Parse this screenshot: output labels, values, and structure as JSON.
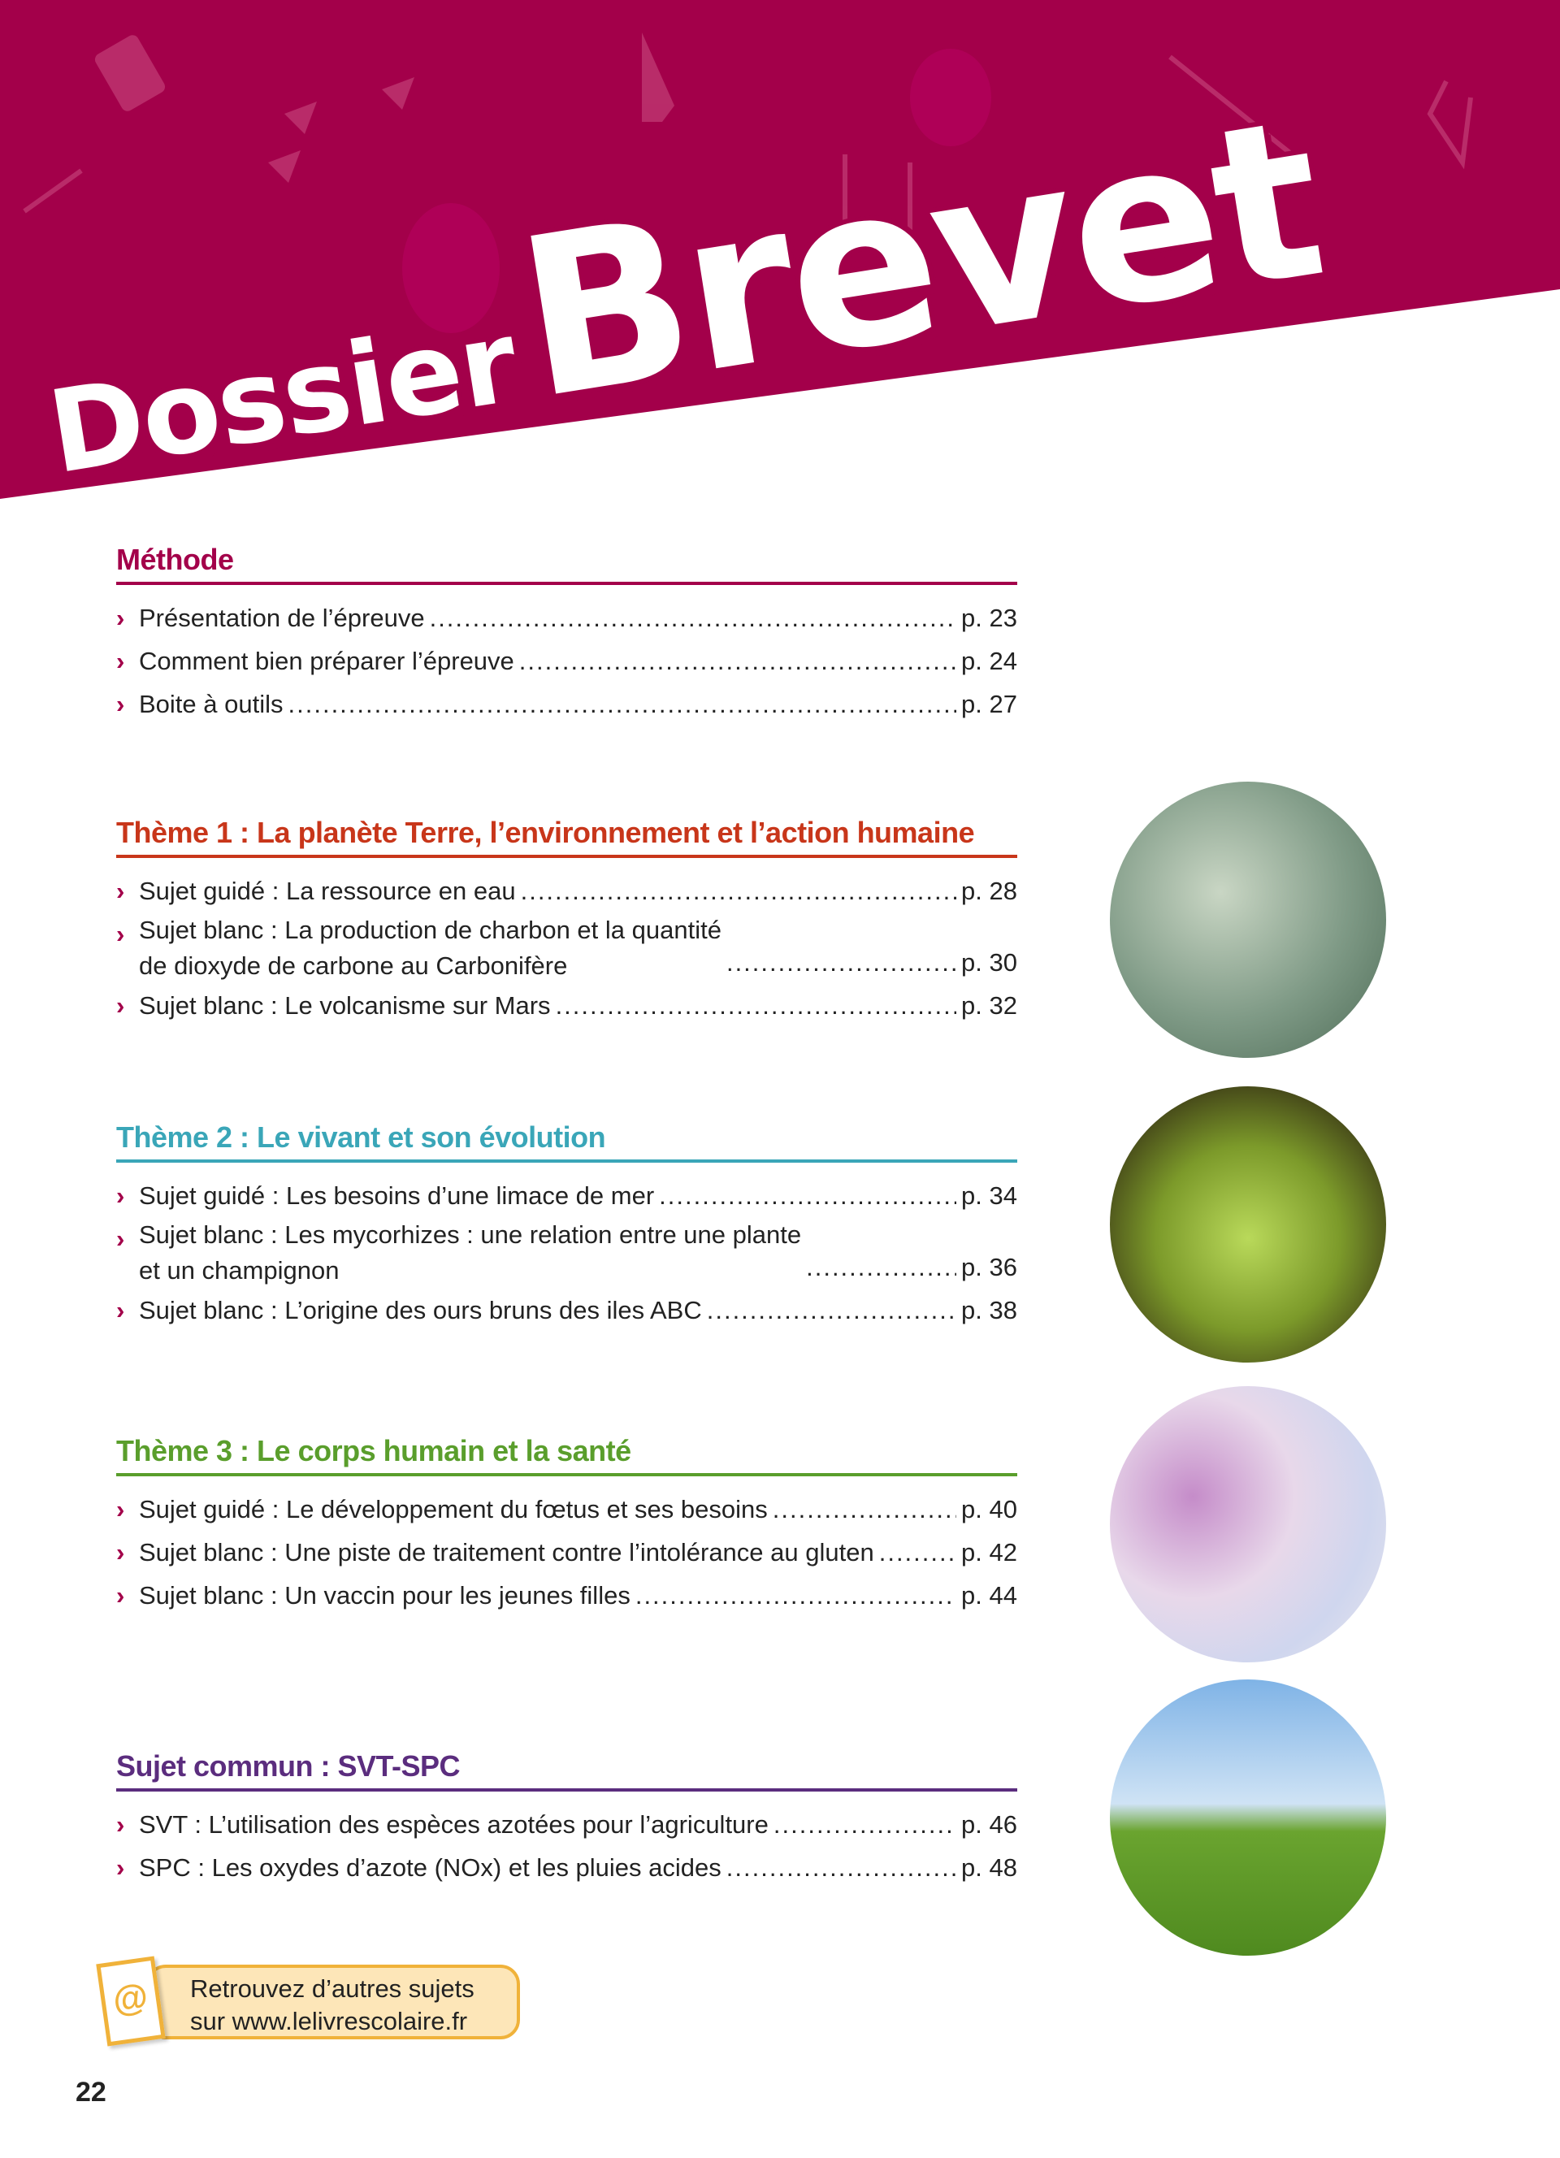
{
  "header": {
    "title_part1": "Dossier",
    "title_part2": "Brevet",
    "banner_color": "#a3004a"
  },
  "sections": [
    {
      "title": "Méthode",
      "color": "#a3004a",
      "items": [
        {
          "text": "Présentation de l’épreuve",
          "page": "p. 23"
        },
        {
          "text": "Comment bien préparer l’épreuve",
          "page": "p. 24"
        },
        {
          "text": "Boite à outils",
          "page": "p. 27"
        }
      ]
    },
    {
      "title": "Thème 1 : La planète Terre, l’environnement et l’action humaine",
      "color": "#c8361a",
      "items": [
        {
          "text": "Sujet guidé : La ressource en eau",
          "page": "p. 28"
        },
        {
          "text": "Sujet blanc : La production de charbon et la quantité",
          "text2": "de dioxyde de carbone au Carbonifère",
          "page": "p. 30"
        },
        {
          "text": "Sujet blanc : Le volcanisme sur Mars",
          "page": "p. 32"
        }
      ]
    },
    {
      "title": "Thème 2 : Le vivant et son évolution",
      "color": "#3aa6b8",
      "items": [
        {
          "text": "Sujet guidé : Les besoins d’une limace de mer",
          "page": "p. 34"
        },
        {
          "text": "Sujet blanc : Les mycorhizes : une relation entre une plante",
          "text2": "et un champignon",
          "page": "p. 36"
        },
        {
          "text": "Sujet blanc : L’origine des ours bruns des iles ABC",
          "page": "p. 38"
        }
      ]
    },
    {
      "title": "Thème 3 : Le corps humain et la santé",
      "color": "#5a9e2c",
      "items": [
        {
          "text": "Sujet guidé : Le développement du fœtus et ses besoins",
          "page": "p. 40"
        },
        {
          "text": "Sujet blanc : Une piste de traitement contre l’intolérance au gluten",
          "page": "p. 42"
        },
        {
          "text": "Sujet blanc : Un vaccin pour les jeunes filles",
          "page": "p. 44"
        }
      ]
    },
    {
      "title": "Sujet commun : SVT-SPC",
      "color": "#5b2d7e",
      "items": [
        {
          "text": "SVT : L’utilisation des espèces azotées pour l’agriculture",
          "page": "p. 46"
        },
        {
          "text": "SPC : Les oxydes d’azote (NOx) et les pluies acides",
          "page": "p. 48"
        }
      ]
    }
  ],
  "callout": {
    "icon": "at-sign-icon",
    "line1": "Retrouvez d’autres sujets",
    "line2": "sur www.lelivrescolaire.fr"
  },
  "page_number": "22"
}
